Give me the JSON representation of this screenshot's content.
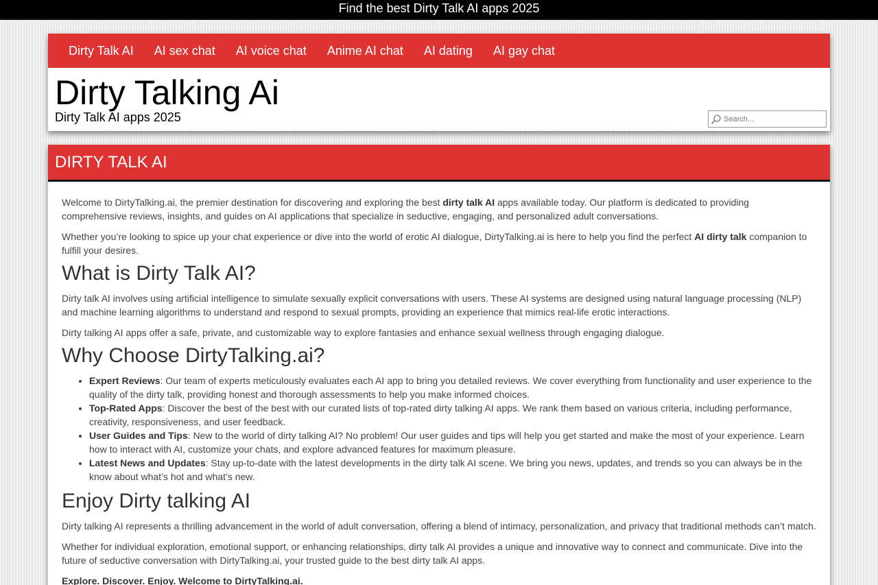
{
  "topbar": {
    "text": "Find the best Dirty Talk AI apps 2025"
  },
  "nav": {
    "items": [
      {
        "label": "Dirty Talk AI"
      },
      {
        "label": "AI sex chat"
      },
      {
        "label": "AI voice chat"
      },
      {
        "label": "Anime AI chat"
      },
      {
        "label": "AI dating"
      },
      {
        "label": "AI gay chat"
      }
    ]
  },
  "site": {
    "title": "Dirty Talking Ai",
    "description": "Dirty Talk AI apps 2025"
  },
  "search": {
    "placeholder": "Search...",
    "icon": "magnifier-icon"
  },
  "content": {
    "heading": "DIRTY TALK AI",
    "intro1": {
      "before": "Welcome to DirtyTalking.ai, the premier destination for discovering and exploring the best ",
      "bold": "dirty talk AI",
      "after": " apps available today. Our platform is dedicated to providing comprehensive reviews, insights, and guides on AI applications that specialize in seductive, engaging, and personalized adult conversations."
    },
    "intro2": {
      "before": "Whether you’re looking to spice up your chat experience or dive into the world of erotic AI dialogue, DirtyTalking.ai is here to help you find the perfect ",
      "bold": "AI dirty talk",
      "after": " companion to fulfill your desires."
    },
    "h_what": "What is Dirty Talk AI?",
    "what1": "Dirty talk AI involves using artificial intelligence to simulate sexually explicit conversations with users. These AI systems are designed using natural language processing (NLP) and machine learning algorithms to understand and respond to sexual prompts, providing an experience that mimics real-life erotic interactions.",
    "what2": "Dirty talking AI apps offer a safe, private, and customizable way to explore fantasies and enhance sexual wellness through engaging dialogue.",
    "h_why": "Why Choose DirtyTalking.ai?",
    "why": [
      {
        "bold": "Expert Reviews",
        "text": ": Our team of experts meticulously evaluates each AI app to bring you detailed reviews. We cover everything from functionality and user experience to the quality of the dirty talk, providing honest and thorough assessments to help you make informed choices."
      },
      {
        "bold": "Top-Rated Apps",
        "text": ": Discover the best of the best with our curated lists of top-rated dirty talking AI apps. We rank them based on various criteria, including performance, creativity, responsiveness, and user feedback."
      },
      {
        "bold": "User Guides and Tips",
        "text": ": New to the world of dirty talking AI? No problem! Our user guides and tips will help you get started and make the most of your experience. Learn how to interact with AI, customize your chats, and explore advanced features for maximum pleasure."
      },
      {
        "bold": "Latest News and Updates",
        "text": ": Stay up-to-date with the latest developments in the dirty talk AI scene. We bring you news, updates, and trends so you can always be in the know about what’s hot and what’s new."
      }
    ],
    "h_enjoy": "Enjoy Dirty talking AI",
    "enjoy1": "Dirty talking AI represents a thrilling advancement in the world of adult conversation, offering a blend of intimacy, personalization, and privacy that traditional methods can’t match.",
    "enjoy2": "Whether for individual exploration, emotional support, or enhancing relationships, dirty talk AI provides a unique and innovative way to connect and communicate. Dive into the future of seductive conversation with DirtyTalking.ai, your trusted guide to the best dirty talk AI apps.",
    "closing": "Explore. Discover. Enjoy. Welcome to DirtyTalking.ai."
  },
  "colors": {
    "accent": "#dd3333",
    "topbar": "#000000"
  }
}
